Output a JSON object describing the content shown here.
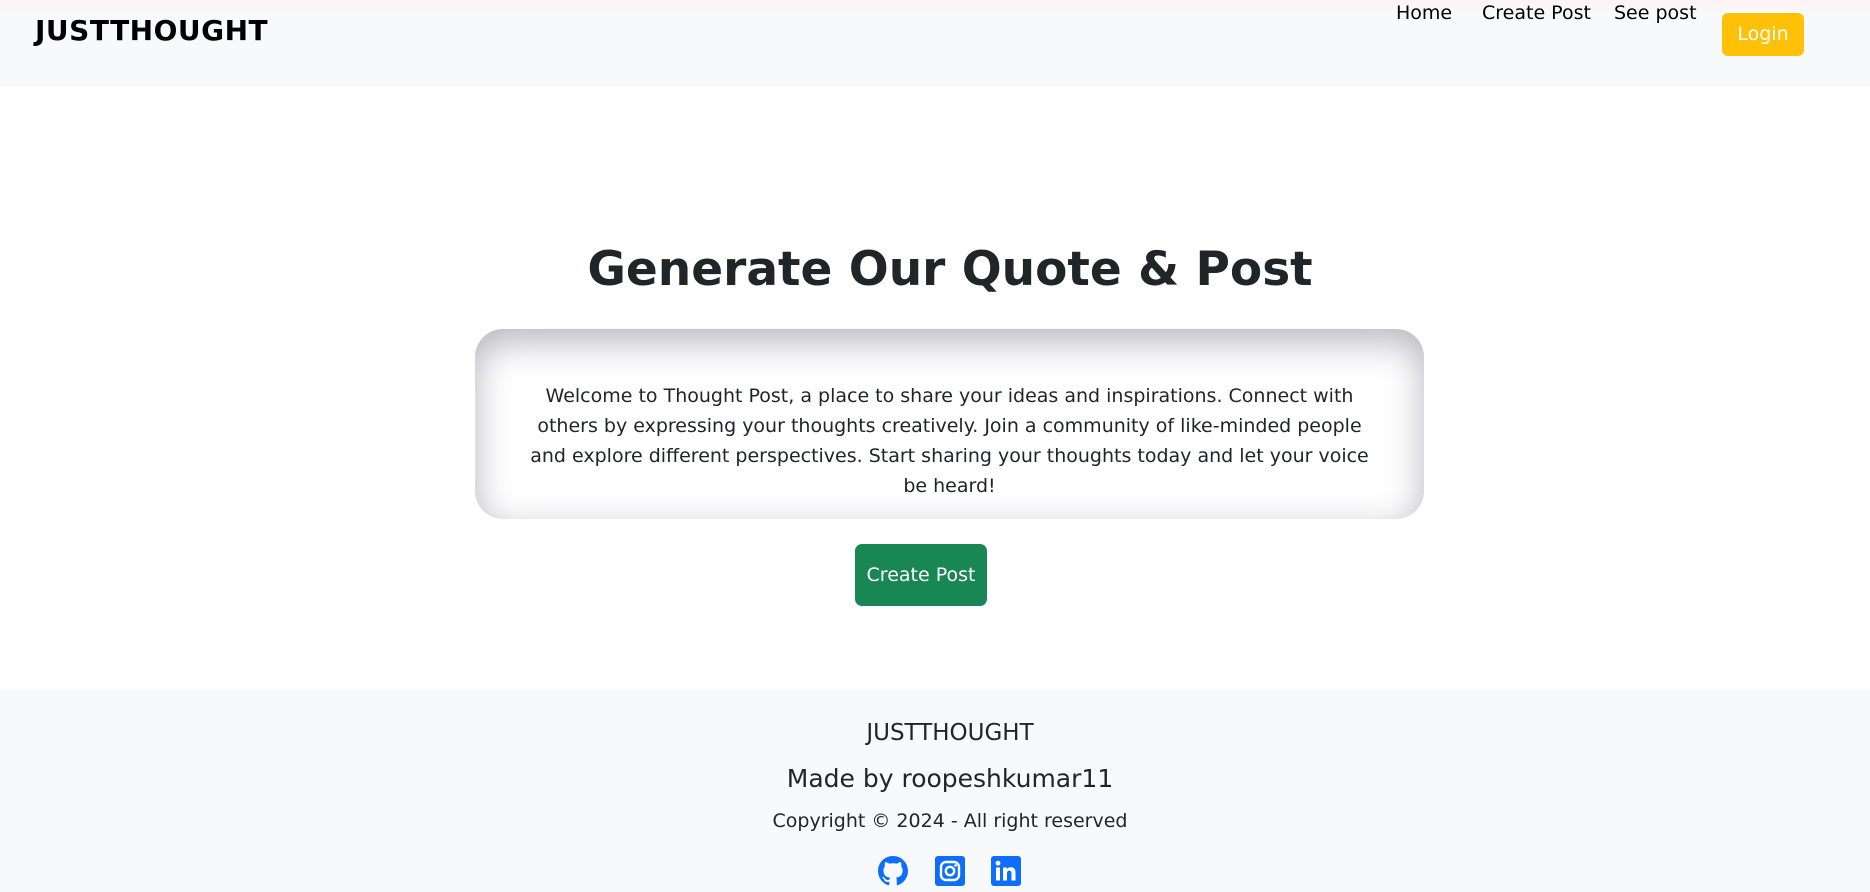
{
  "navbar": {
    "brand": "JUSTTHOUGHT",
    "links": [
      "Home",
      "Create Post",
      "See post"
    ],
    "login_label": "Login"
  },
  "hero": {
    "title": "Generate Our Quote & Post",
    "intro": "Welcome to Thought Post, a place to share your ideas and inspirations. Connect with others by expressing your thoughts creatively. Join a community of like-minded people and explore different perspectives. Start sharing your thoughts today and let your voice be heard!",
    "cta_label": "Create Post"
  },
  "footer": {
    "brand": "JUSTTHOUGHT",
    "made_by": "Made by roopeshkumar11",
    "copyright": "Copyright © 2024 - All right reserved",
    "social_icons": [
      "github-icon",
      "instagram-icon",
      "linkedin-icon"
    ]
  },
  "colors": {
    "login_button": "#ffc107",
    "cta_button": "#198754",
    "social_icons": "#0d6efd",
    "navbar_bg": "#f8f9fa"
  }
}
